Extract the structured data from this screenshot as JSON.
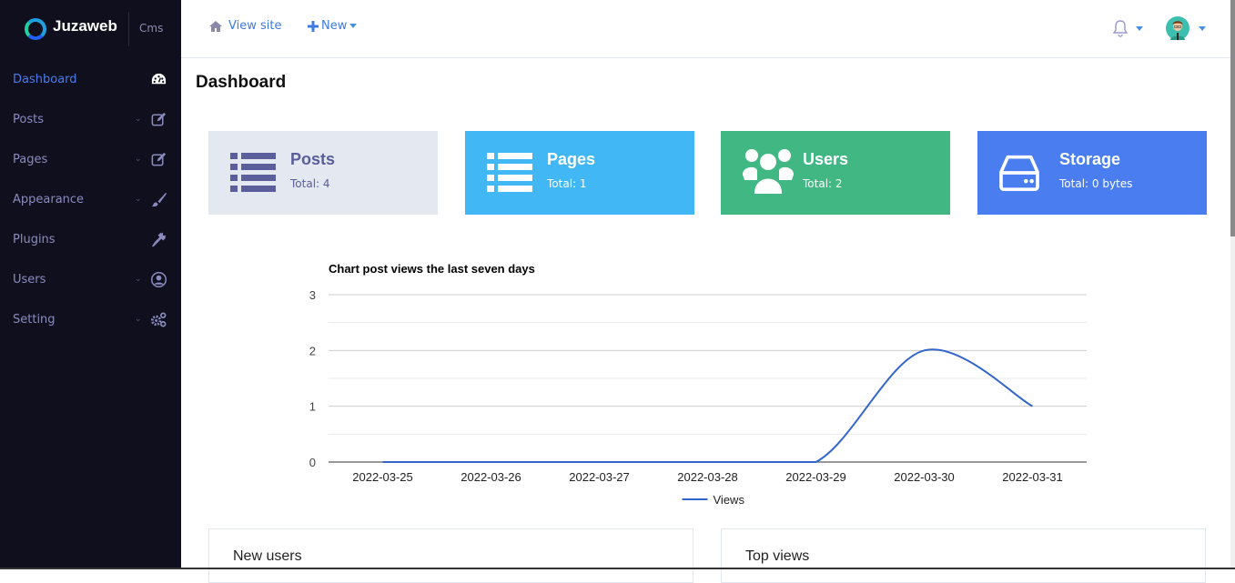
{
  "brand": {
    "name": "Juzaweb",
    "suffix": "Cms"
  },
  "sidebar": {
    "items": [
      {
        "label": "Dashboard",
        "icon": "tachometer-icon",
        "active": true,
        "expandable": false
      },
      {
        "label": "Posts",
        "icon": "edit-icon",
        "active": false,
        "expandable": true
      },
      {
        "label": "Pages",
        "icon": "edit-icon",
        "active": false,
        "expandable": true
      },
      {
        "label": "Appearance",
        "icon": "paint-brush-icon",
        "active": false,
        "expandable": true
      },
      {
        "label": "Plugins",
        "icon": "plug-icon",
        "active": false,
        "expandable": false
      },
      {
        "label": "Users",
        "icon": "user-circle-icon",
        "active": false,
        "expandable": true
      },
      {
        "label": "Setting",
        "icon": "cogs-icon",
        "active": false,
        "expandable": true
      }
    ]
  },
  "topbar": {
    "view_site": "View site",
    "new": "New"
  },
  "page": {
    "title": "Dashboard"
  },
  "cards": [
    {
      "title": "Posts",
      "subtitle": "Total: 4",
      "icon": "list-icon",
      "bg": "#e4e8f0",
      "fg": "#5a5e9a"
    },
    {
      "title": "Pages",
      "subtitle": "Total: 1",
      "icon": "list-icon",
      "bg": "#41b8f5",
      "fg": "#ffffff"
    },
    {
      "title": "Users",
      "subtitle": "Total: 2",
      "icon": "users-icon",
      "bg": "#41b883",
      "fg": "#ffffff"
    },
    {
      "title": "Storage",
      "subtitle": "Total: 0 bytes",
      "icon": "hdd-icon",
      "bg": "#4a7ef0",
      "fg": "#ffffff"
    }
  ],
  "chart_data": {
    "type": "line",
    "title": "Chart post views the last seven days",
    "categories": [
      "2022-03-25",
      "2022-03-26",
      "2022-03-27",
      "2022-03-28",
      "2022-03-29",
      "2022-03-30",
      "2022-03-31"
    ],
    "series": [
      {
        "name": "Views",
        "values": [
          0,
          0,
          0,
          0,
          0,
          2,
          1
        ],
        "color": "#3366cc"
      }
    ],
    "yticks": [
      "0",
      "1",
      "2",
      "3"
    ],
    "ylim": [
      0,
      3
    ],
    "xlabel": "",
    "ylabel": "",
    "grid": true,
    "legend": "bottom",
    "smooth": true
  },
  "panels": [
    {
      "title": "New users"
    },
    {
      "title": "Top views"
    }
  ]
}
